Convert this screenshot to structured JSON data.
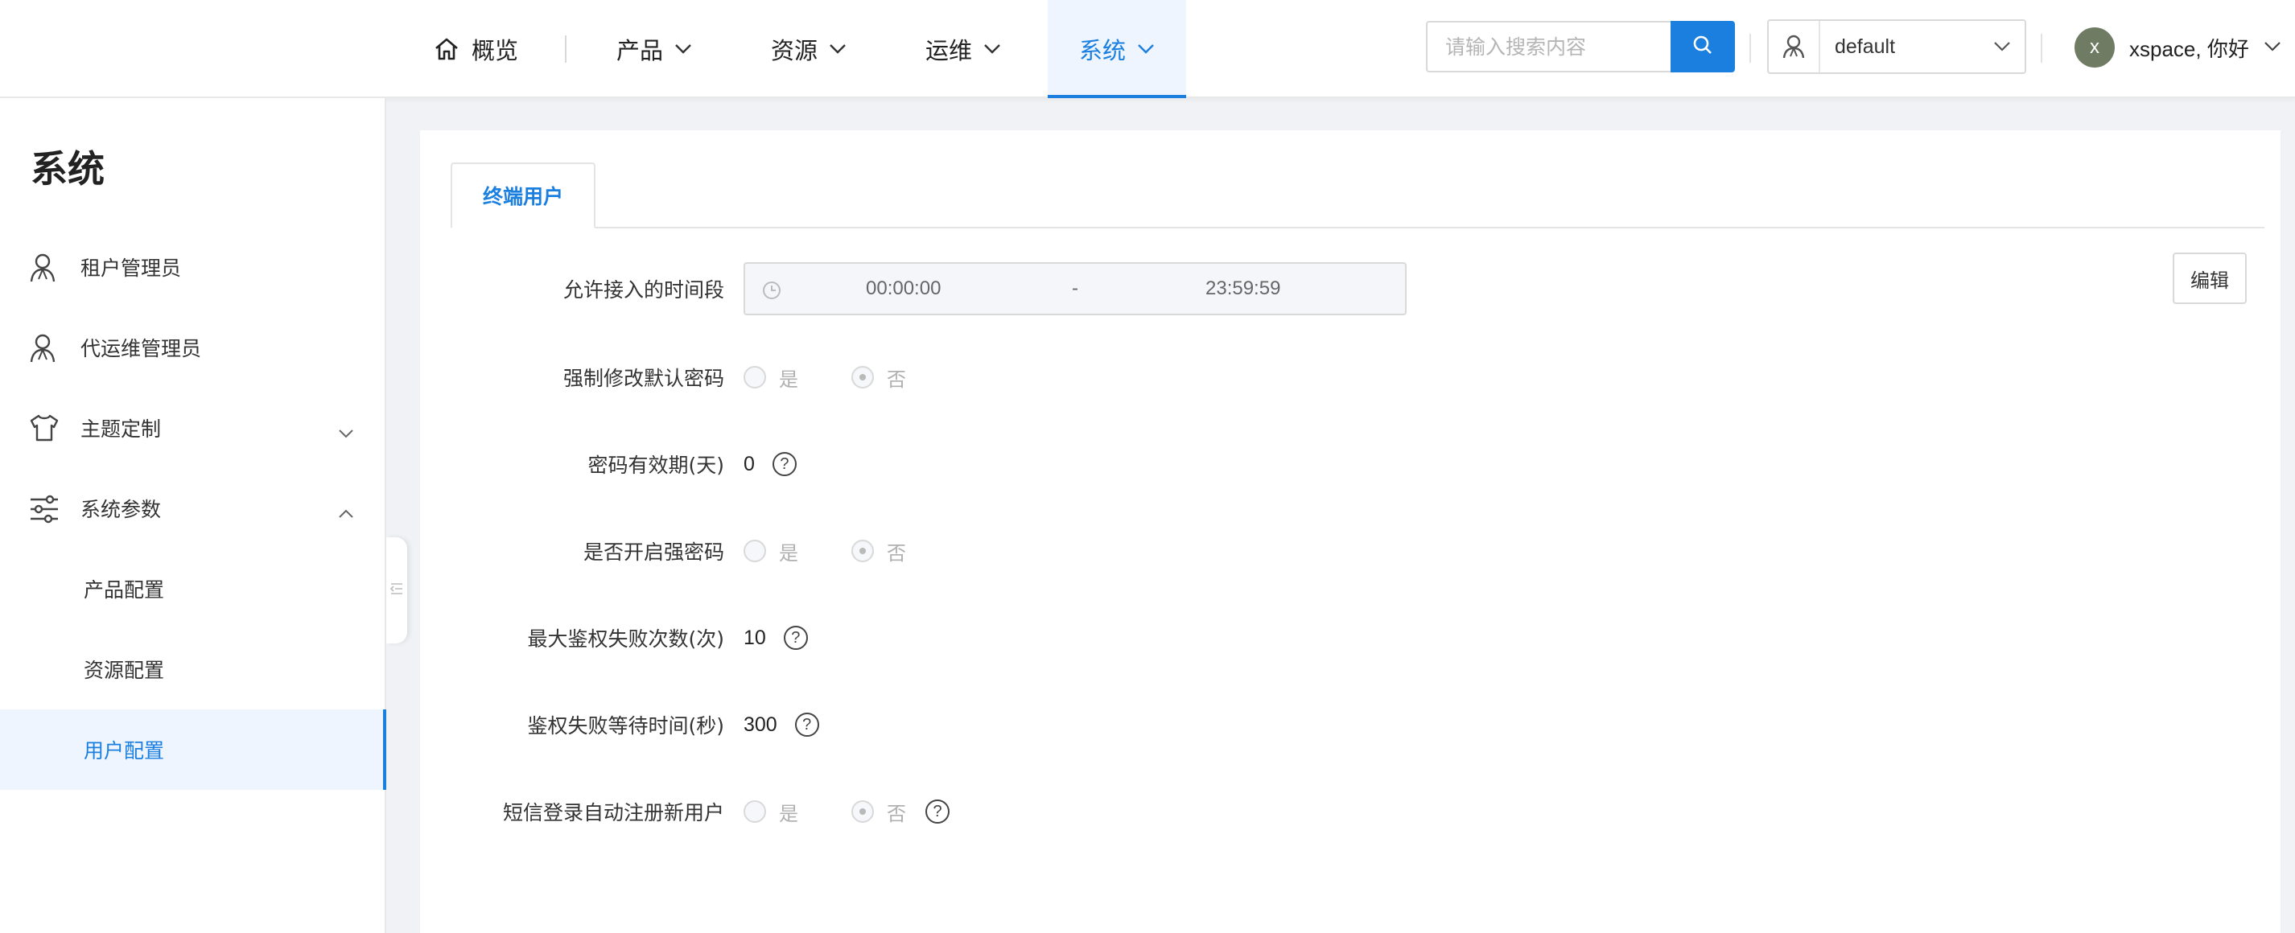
{
  "header": {
    "nav": [
      {
        "label": "概览",
        "icon": "home-icon",
        "has_dropdown": false
      },
      {
        "label": "产品",
        "has_dropdown": true
      },
      {
        "label": "资源",
        "has_dropdown": true
      },
      {
        "label": "运维",
        "has_dropdown": true
      },
      {
        "label": "系统",
        "has_dropdown": true,
        "active": true
      }
    ],
    "search": {
      "placeholder": "请输入搜索内容",
      "value": ""
    },
    "tenant": {
      "value": "default"
    },
    "user": {
      "avatar_letter": "x",
      "greeting": "xspace, 你好"
    }
  },
  "sidebar": {
    "title": "系统",
    "items": [
      {
        "label": "租户管理员",
        "icon": "user-icon"
      },
      {
        "label": "代运维管理员",
        "icon": "user-icon"
      },
      {
        "label": "主题定制",
        "icon": "shirt-icon",
        "expanded": false
      },
      {
        "label": "系统参数",
        "icon": "sliders-icon",
        "expanded": true
      },
      {
        "label": "产品配置"
      },
      {
        "label": "资源配置"
      },
      {
        "label": "用户配置",
        "active": true
      }
    ]
  },
  "main": {
    "tabs": [
      {
        "label": "终端用户",
        "active": true
      }
    ],
    "edit_label": "编辑",
    "fields": {
      "time_range": {
        "label": "允许接入的时间段",
        "start": "00:00:00",
        "sep": "-",
        "end": "23:59:59"
      },
      "force_change_pwd": {
        "label": "强制修改默认密码",
        "yes": "是",
        "no": "否",
        "selected": "否"
      },
      "pwd_validity": {
        "label": "密码有效期(天)",
        "value": "0"
      },
      "strong_pwd": {
        "label": "是否开启强密码",
        "yes": "是",
        "no": "否",
        "selected": "否"
      },
      "max_auth_fail": {
        "label": "最大鉴权失败次数(次)",
        "value": "10"
      },
      "auth_wait": {
        "label": "鉴权失败等待时间(秒)",
        "value": "300"
      },
      "sms_auto_register": {
        "label": "短信登录自动注册新用户",
        "yes": "是",
        "no": "否",
        "selected": "否"
      }
    }
  },
  "colors": {
    "accent": "#1b7fe0",
    "active_bg": "#eef5fe",
    "avatar": "#6f7c63"
  }
}
